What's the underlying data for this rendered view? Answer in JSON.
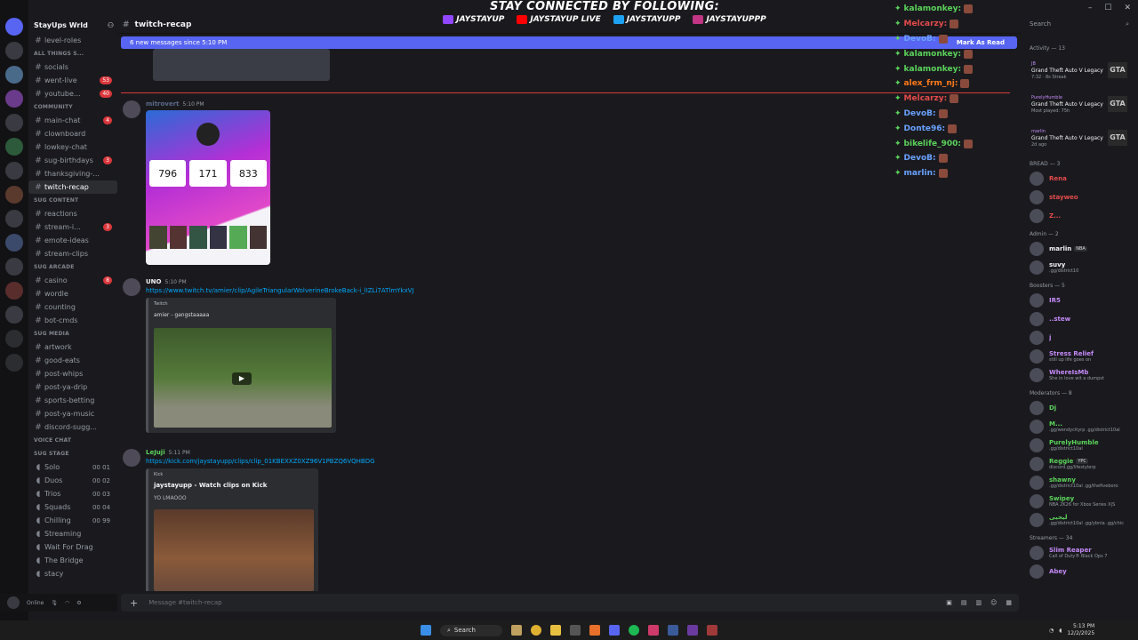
{
  "overlay": {
    "title": "STAY CONNECTED BY FOLLOWING:",
    "links": [
      {
        "label": "JAYSTAYUP",
        "icon": "twitch-icon",
        "color": "#9146ff"
      },
      {
        "label": "JAYSTAYUP LIVE",
        "icon": "youtube-icon",
        "color": "#ff0000"
      },
      {
        "label": "JAYSTAYUPP",
        "icon": "twitter-icon",
        "color": "#1da1f2"
      },
      {
        "label": "JAYSTAYUPPP",
        "icon": "instagram-icon",
        "color": "#c13584"
      }
    ]
  },
  "server": {
    "name": "StayUps Wrld"
  },
  "channels": [
    {
      "type": "channel",
      "label": "level-roles"
    },
    {
      "type": "category",
      "label": "ALL THINGS S..."
    },
    {
      "type": "channel",
      "label": "socials"
    },
    {
      "type": "channel",
      "label": "went-live",
      "badge": "53"
    },
    {
      "type": "channel",
      "label": "youtube...",
      "badge": "40"
    },
    {
      "type": "category",
      "label": "COMMUNITY"
    },
    {
      "type": "channel",
      "label": "main-chat",
      "badge": "4"
    },
    {
      "type": "channel",
      "label": "clownboard"
    },
    {
      "type": "channel",
      "label": "lowkey-chat"
    },
    {
      "type": "channel",
      "label": "sug-birthdays",
      "badge": "3"
    },
    {
      "type": "channel",
      "label": "thanksgiving-..."
    },
    {
      "type": "channel",
      "label": "twitch-recap",
      "selected": true
    },
    {
      "type": "category",
      "label": "SUG CONTENT"
    },
    {
      "type": "channel",
      "label": "reactions"
    },
    {
      "type": "channel",
      "label": "stream-i...",
      "badge": "3"
    },
    {
      "type": "channel",
      "label": "emote-ideas"
    },
    {
      "type": "channel",
      "label": "stream-clips"
    },
    {
      "type": "category",
      "label": "SUG ARCADE"
    },
    {
      "type": "channel",
      "label": "casino",
      "badge": "8"
    },
    {
      "type": "channel",
      "label": "wordle"
    },
    {
      "type": "channel",
      "label": "counting"
    },
    {
      "type": "channel",
      "label": "bot-cmds"
    },
    {
      "type": "category",
      "label": "SUG MEDIA"
    },
    {
      "type": "channel",
      "label": "artwork"
    },
    {
      "type": "channel",
      "label": "good-eats"
    },
    {
      "type": "channel",
      "label": "post-whips"
    },
    {
      "type": "channel",
      "label": "post-ya-drip"
    },
    {
      "type": "channel",
      "label": "sports-betting"
    },
    {
      "type": "channel",
      "label": "post-ya-music"
    },
    {
      "type": "channel",
      "label": "discord-sugg..."
    },
    {
      "type": "category",
      "label": "VOICE CHAT"
    },
    {
      "type": "category",
      "label": "SUG STAGE"
    },
    {
      "type": "voice",
      "label": "Solo",
      "count": "00 01"
    },
    {
      "type": "voice",
      "label": "Duos",
      "count": "00 02"
    },
    {
      "type": "voice",
      "label": "Trios",
      "count": "00 03"
    },
    {
      "type": "voice",
      "label": "Squads",
      "count": "00 04"
    },
    {
      "type": "voice",
      "label": "Chilling",
      "count": "00 99"
    },
    {
      "type": "voice",
      "label": "Streaming"
    },
    {
      "type": "voice",
      "label": "Wait For Drag"
    },
    {
      "type": "voice",
      "label": "The Bridge"
    },
    {
      "type": "voice",
      "label": "stacy"
    }
  ],
  "user": {
    "status": "Online"
  },
  "channel_header": {
    "name": "twitch-recap"
  },
  "new_messages": {
    "text": "6 new messages since 5:10 PM",
    "action": "Mark As Read"
  },
  "messages": [
    {
      "author": "mitrovert",
      "time": "5:10 PM",
      "card": {
        "stats": [
          "796",
          "171",
          "833"
        ]
      }
    },
    {
      "author": "UNO",
      "time": "5:10 PM",
      "link": "https://www.twitch.tv/amier/clip/AgileTriangularWolverineBrokeBack-i_lIZLi7ATlmYkxVJ",
      "embed": {
        "provider": "Twitch",
        "title": "amier - gangstaaaaa"
      }
    },
    {
      "author": "LeJuji",
      "time": "5:11 PM",
      "link": "https://kick.com/jaystayupp/clips/clip_01KBEXXZ0XZ96V1PBZQ6VQHBDG",
      "embed": {
        "provider": "Kick",
        "title": "jaystayupp - Watch clips on Kick",
        "desc": "YO LMAOOO"
      }
    }
  ],
  "input": {
    "placeholder": "Message #twitch-recap"
  },
  "stream_chat": [
    {
      "name": "kalamonkey:",
      "color": "#5bd35b"
    },
    {
      "name": "Melcarzy:",
      "color": "#e64b4b"
    },
    {
      "name": "DevoB:",
      "color": "#6aa2ff"
    },
    {
      "name": "kalamonkey:",
      "color": "#5bd35b"
    },
    {
      "name": "kalamonkey:",
      "color": "#5bd35b"
    },
    {
      "name": "alex_frm_nj:",
      "color": "#ff7a1a"
    },
    {
      "name": "Melcarzy:",
      "color": "#e64b4b"
    },
    {
      "name": "DevoB:",
      "color": "#6aa2ff"
    },
    {
      "name": "Donte96:",
      "color": "#6aa2ff"
    },
    {
      "name": "bikelife_900:",
      "color": "#5bd35b"
    },
    {
      "name": "DevoB:",
      "color": "#6aa2ff"
    },
    {
      "name": "marlin:",
      "color": "#6aa2ff"
    }
  ],
  "members": {
    "search_placeholder": "Search",
    "activity_header": "Activity — 13",
    "activities": [
      {
        "name": "JB",
        "game": "Grand Theft Auto V Legacy",
        "detail": "7:32 · 8s Streak"
      },
      {
        "name": "PurelyHumble",
        "game": "Grand Theft Auto V Legacy",
        "detail": "Most played: 75h"
      },
      {
        "name": "marlin",
        "game": "Grand Theft Auto V Legacy",
        "detail": "2d ago"
      }
    ],
    "gta_label": "GTA",
    "groups": [
      {
        "header": "BREAD — 3",
        "items": [
          {
            "name": "Rena",
            "color": "#e64b4b"
          },
          {
            "name": "stayweo",
            "color": "#e64b4b"
          },
          {
            "name": "Z...",
            "color": "#e64b4b"
          }
        ]
      },
      {
        "header": "Admin — 2",
        "items": [
          {
            "name": "marlin",
            "color": "#f2f3f5",
            "tag": "NBA"
          },
          {
            "name": "suvy",
            "color": "#f2f3f5",
            "sub": ".gg/district10"
          }
        ]
      },
      {
        "header": "Boosters — 5",
        "items": [
          {
            "name": "IR5",
            "color": "#c58af9"
          },
          {
            "name": "..stew",
            "color": "#c58af9"
          },
          {
            "name": "j",
            "color": "#c58af9"
          },
          {
            "name": "Stress Relief",
            "color": "#c58af9",
            "sub": "still up life goes on"
          },
          {
            "name": "WhereIsMb",
            "color": "#c58af9",
            "sub": "She in love wit a dumpst"
          }
        ]
      },
      {
        "header": "Moderators — 8",
        "items": [
          {
            "name": "Dj",
            "color": "#5bd35b"
          },
          {
            "name": "M...",
            "color": "#5bd35b",
            "sub": ".gg/wendycityrp .gg/district10al"
          },
          {
            "name": "PurelyHumble",
            "color": "#5bd35b",
            "sub": ".gg/district10al"
          },
          {
            "name": "Reggie",
            "color": "#5bd35b",
            "tag": "YPC",
            "sub": "discord.gg/lifestylerp"
          },
          {
            "name": "shawny",
            "color": "#5bd35b",
            "sub": ".gg/district10al .gg/thefiveboro"
          },
          {
            "name": "Swipey",
            "color": "#5bd35b",
            "sub": "NBA 2K26 for Xbox Series X|S"
          },
          {
            "name": "ليحيى",
            "color": "#5bd35b",
            "sub": ".gg/district10al .gg/ybnla .gg/chic"
          }
        ]
      },
      {
        "header": "Streamers — 34",
        "items": [
          {
            "name": "Slim Reaper",
            "color": "#c58af9",
            "sub": "Call of Duty® Black Ops 7"
          },
          {
            "name": "Abey",
            "color": "#c58af9"
          }
        ]
      }
    ]
  },
  "taskbar": {
    "search": "Search",
    "time": "5:13 PM",
    "date": "12/2/2025"
  }
}
